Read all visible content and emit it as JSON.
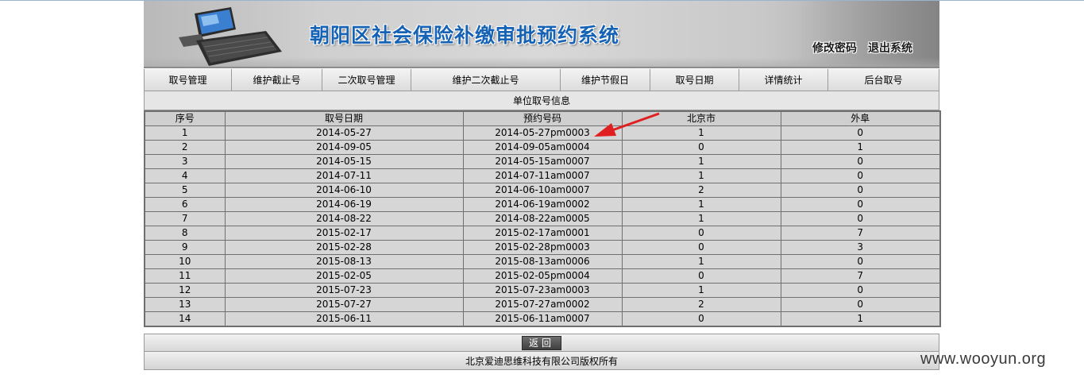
{
  "header": {
    "title": "朝阳区社会保险补缴审批预约系统",
    "change_password": "修改密码",
    "logout": "退出系统"
  },
  "nav": [
    {
      "label": "取号管理",
      "name": "nav-ticket-management"
    },
    {
      "label": "维护截止号",
      "name": "nav-maintain-cutoff"
    },
    {
      "label": "二次取号管理",
      "name": "nav-second-ticket-management"
    },
    {
      "label": "维护二次截止号",
      "name": "nav-maintain-second-cutoff"
    },
    {
      "label": "维护节假日",
      "name": "nav-maintain-holidays"
    },
    {
      "label": "取号日期",
      "name": "nav-ticket-dates"
    },
    {
      "label": "详情统计",
      "name": "nav-detail-statistics"
    },
    {
      "label": "后台取号",
      "name": "nav-backend-ticket"
    }
  ],
  "section": {
    "title": "单位取号信息"
  },
  "table": {
    "columns": [
      "序号",
      "取号日期",
      "预约号码",
      "北京市",
      "外阜"
    ],
    "rows": [
      [
        "1",
        "2014-05-27",
        "2014-05-27pm0003",
        "1",
        "0"
      ],
      [
        "2",
        "2014-09-05",
        "2014-09-05am0004",
        "0",
        "1"
      ],
      [
        "3",
        "2014-05-15",
        "2014-05-15am0007",
        "1",
        "0"
      ],
      [
        "4",
        "2014-07-11",
        "2014-07-11am0007",
        "1",
        "0"
      ],
      [
        "5",
        "2014-06-10",
        "2014-06-10am0007",
        "2",
        "0"
      ],
      [
        "6",
        "2014-06-19",
        "2014-06-19am0002",
        "1",
        "0"
      ],
      [
        "7",
        "2014-08-22",
        "2014-08-22am0005",
        "1",
        "0"
      ],
      [
        "8",
        "2015-02-17",
        "2015-02-17am0001",
        "0",
        "7"
      ],
      [
        "9",
        "2015-02-28",
        "2015-02-28pm0003",
        "0",
        "3"
      ],
      [
        "10",
        "2015-08-13",
        "2015-08-13am0006",
        "1",
        "0"
      ],
      [
        "11",
        "2015-02-05",
        "2015-02-05pm0004",
        "0",
        "7"
      ],
      [
        "12",
        "2015-07-23",
        "2015-07-23am0003",
        "1",
        "0"
      ],
      [
        "13",
        "2015-07-27",
        "2015-07-27am0002",
        "2",
        "0"
      ],
      [
        "14",
        "2015-06-11",
        "2015-06-11am0007",
        "0",
        "1"
      ]
    ]
  },
  "back_button": "返回",
  "footer": "北京爱迪思维科技有限公司版权所有",
  "watermark": "www.wooyun.org",
  "colors": {
    "title_blue": "#1663b5",
    "arrow_red": "#e02020",
    "cell_gray": "#d6d6d6"
  }
}
